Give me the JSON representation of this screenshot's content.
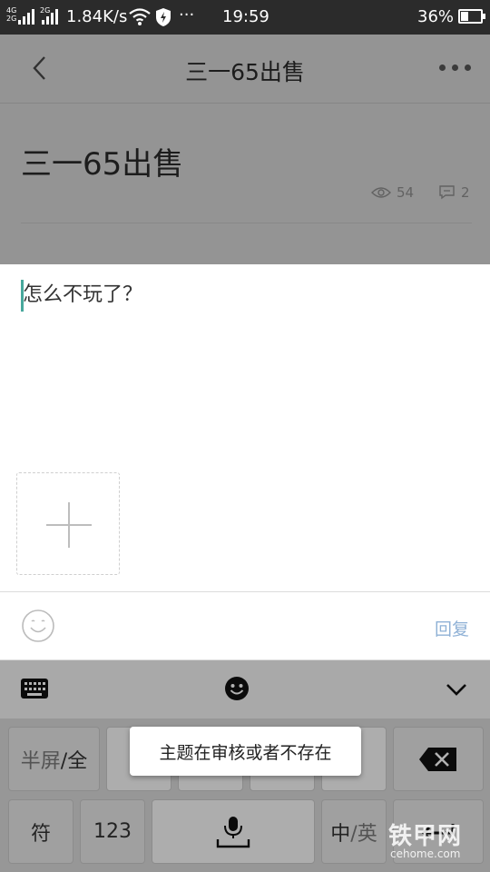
{
  "status_bar": {
    "net1": "4G",
    "net2": "2G",
    "net3": "2G",
    "speed": "1.84K/s",
    "more": "···",
    "time": "19:59",
    "battery_pct": "36%",
    "battery_level": 0.36
  },
  "page": {
    "nav_title": "三一65出售",
    "post_title": "三一65出售",
    "views": "54",
    "comments": "2"
  },
  "editor": {
    "text": "怎么不玩了？"
  },
  "reply_bar": {
    "reply_label": "回复"
  },
  "keyboard": {
    "row1": {
      "halfscreen_main": "半屏",
      "halfscreen_alt": "/全"
    },
    "row2": {
      "symbol": "符",
      "numbers": "123",
      "lang_main": "中",
      "lang_alt": "/英"
    }
  },
  "toast": "主题在审核或者不存在",
  "watermark": {
    "line1": "铁甲网",
    "line2": "cehome.com"
  }
}
